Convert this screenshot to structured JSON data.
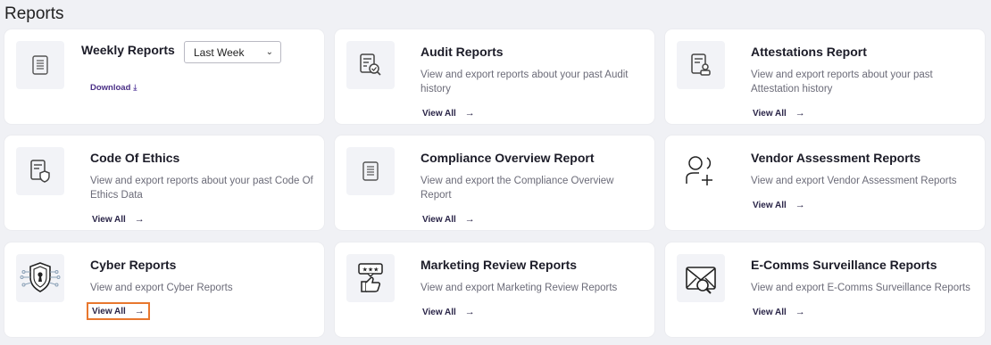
{
  "page": {
    "title": "Reports"
  },
  "cards": {
    "weekly": {
      "title": "Weekly Reports",
      "select_value": "Last Week",
      "download_label": "Download",
      "icon": "document-icon"
    },
    "audit": {
      "title": "Audit Reports",
      "description": "View and export reports about your past Audit history",
      "link_label": "View All",
      "icon": "document-search-icon"
    },
    "attestations": {
      "title": "Attestations Report",
      "description": "View and export reports about your past Attestation history",
      "link_label": "View All",
      "icon": "document-user-icon"
    },
    "ethics": {
      "title": "Code Of Ethics",
      "description": "View and export reports about your past Code Of Ethics Data",
      "link_label": "View All",
      "icon": "document-shield-icon"
    },
    "compliance": {
      "title": "Compliance Overview Report",
      "description": "View and export the Compliance Overview Report",
      "link_label": "View All",
      "icon": "document-icon"
    },
    "vendor": {
      "title": "Vendor Assessment Reports",
      "description": "View and export Vendor Assessment Reports",
      "link_label": "View All",
      "icon": "add-user-icon"
    },
    "cyber": {
      "title": "Cyber Reports",
      "description": "View and export Cyber Reports",
      "link_label": "View All",
      "icon": "cyber-shield-icon"
    },
    "marketing": {
      "title": "Marketing Review Reports",
      "description": "View and export Marketing Review Reports",
      "link_label": "View All",
      "icon": "review-thumbs-up-icon"
    },
    "ecomms": {
      "title": "E-Comms Surveillance Reports",
      "description": "View and export E-Comms Surveillance Reports",
      "link_label": "View All",
      "icon": "mail-search-icon"
    }
  },
  "colors": {
    "background": "#f0f1f5",
    "card": "#ffffff",
    "link": "#2a2548",
    "download_link": "#4a2f86",
    "focus_outline": "#e8772e"
  }
}
